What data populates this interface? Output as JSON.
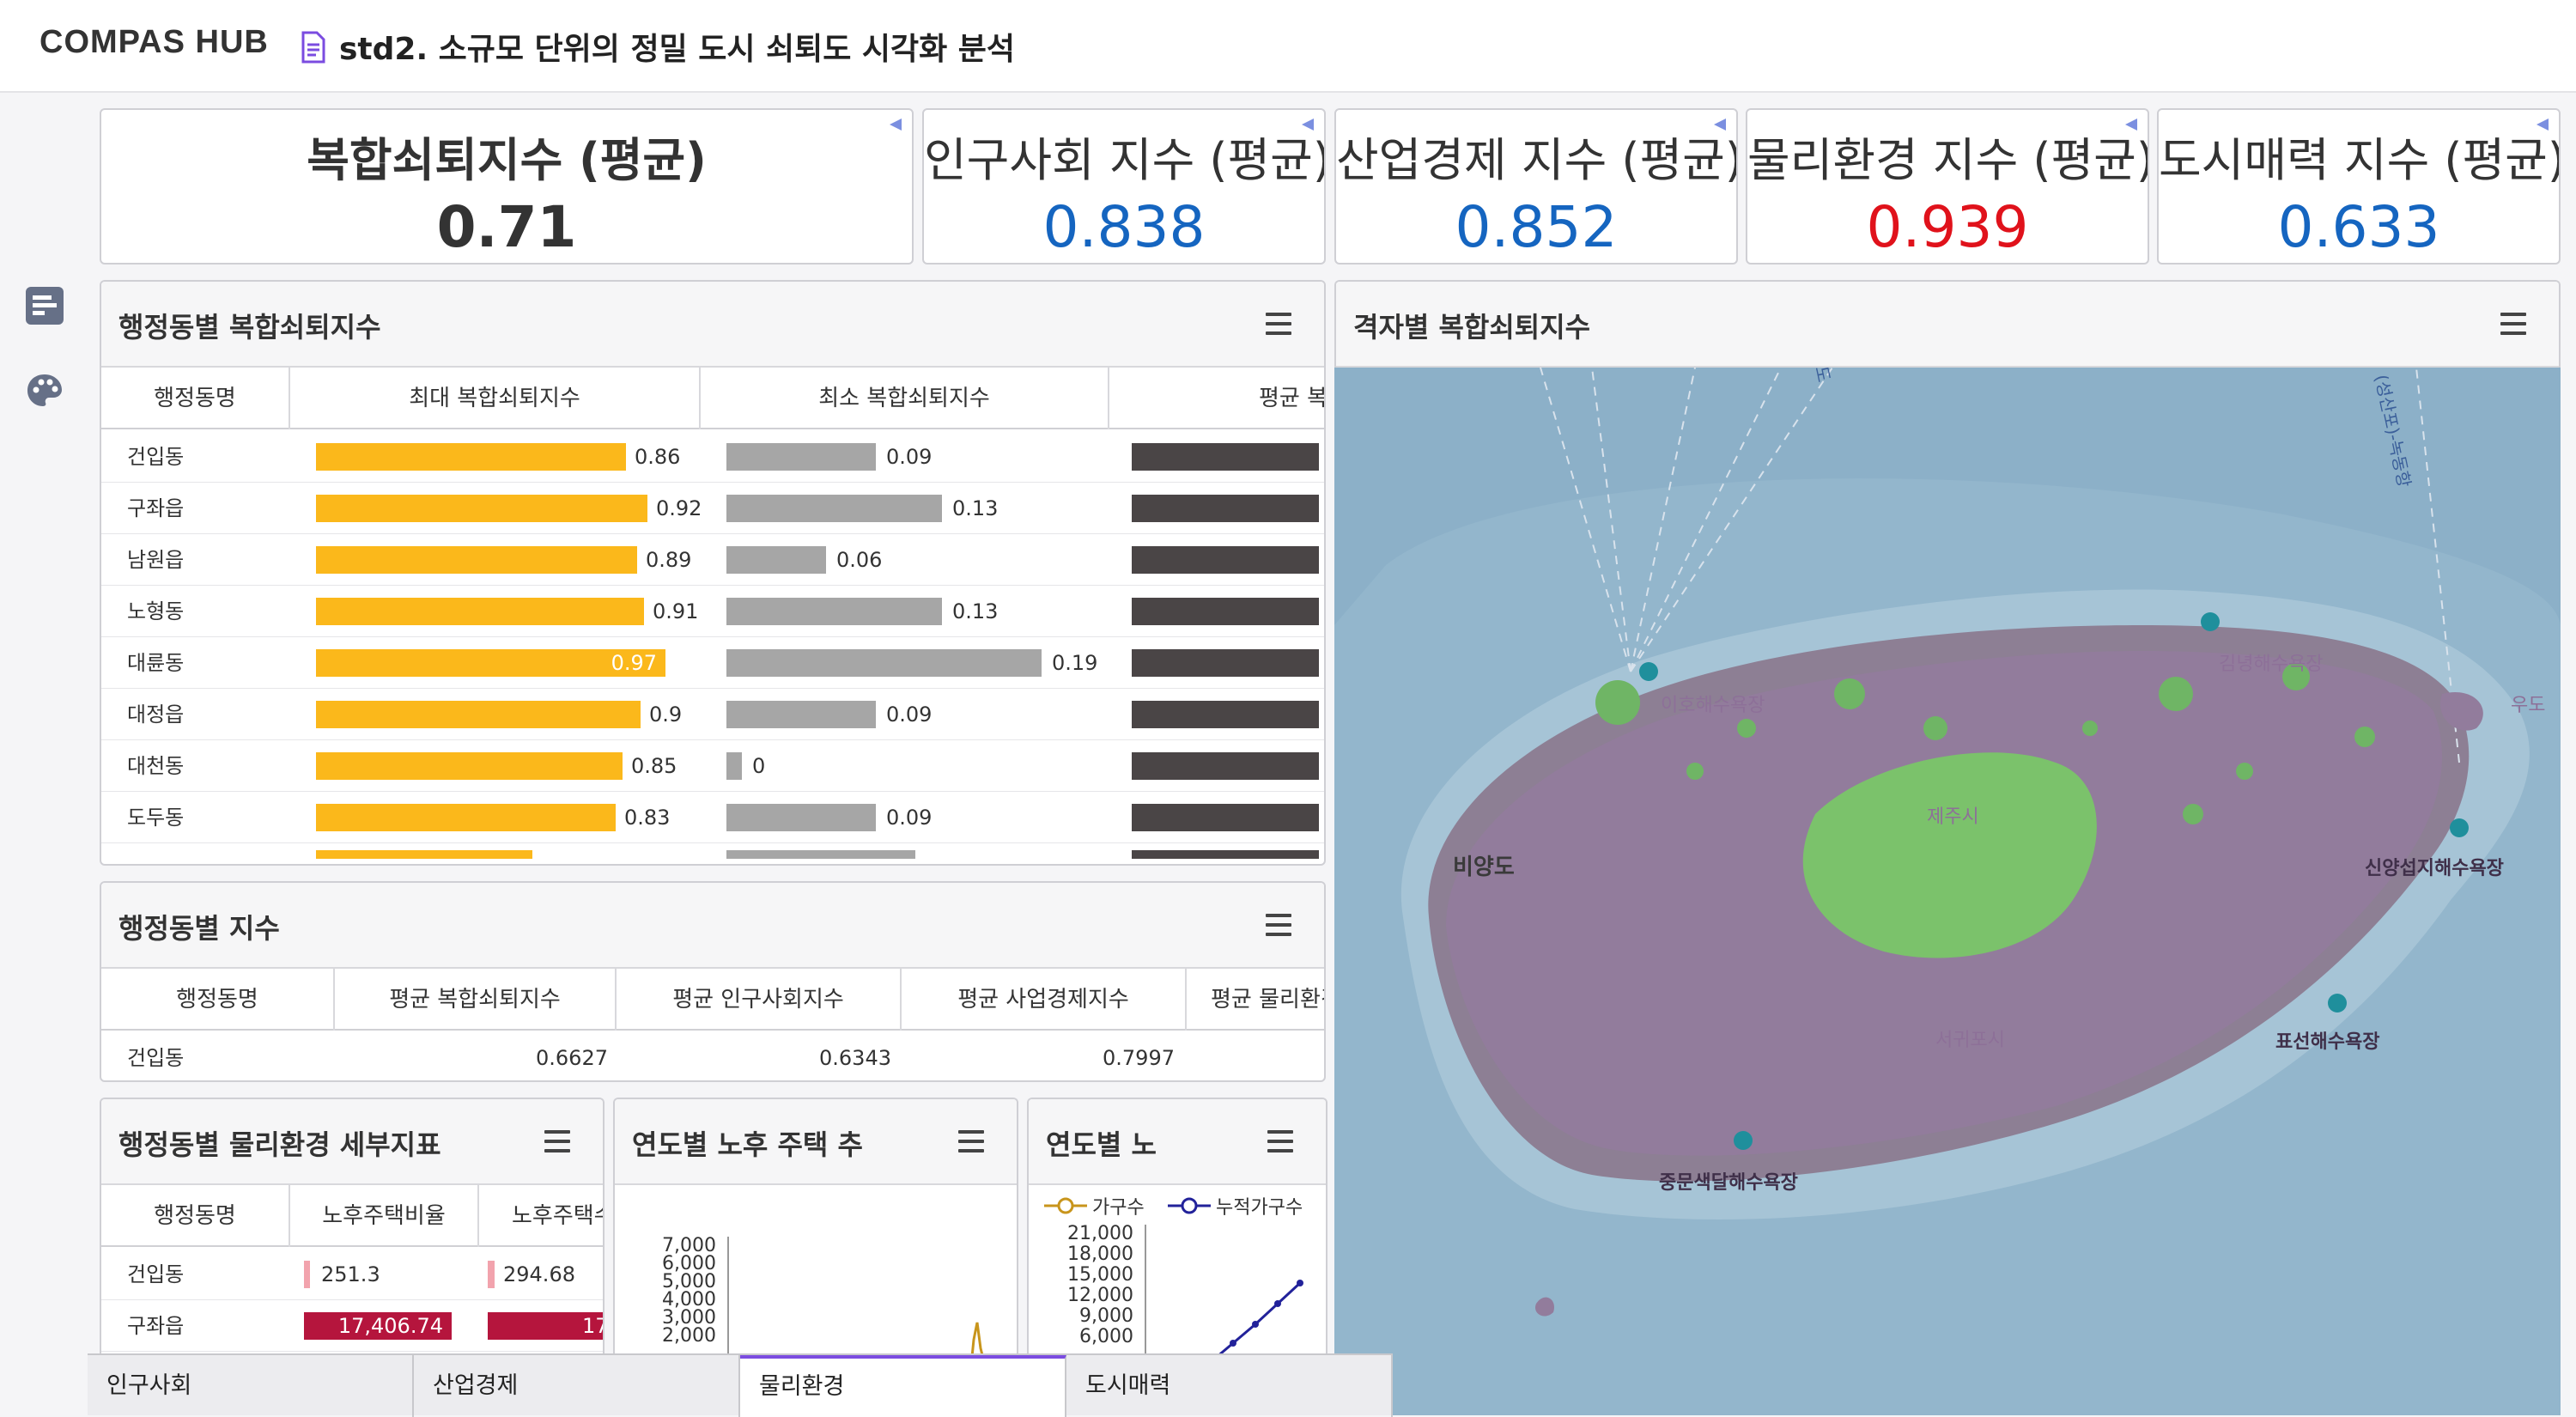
{
  "app": {
    "logo": "COMPAS HUB",
    "title": "std2. 소규모 단위의 정밀 도시 쇠퇴도 시각화 분석"
  },
  "kpis": [
    {
      "title": "복합쇠퇴지수  (평균)",
      "value": "0.71",
      "color": "#333333"
    },
    {
      "title": "인구사회 지수 (평균)",
      "value": "0.838",
      "color": "#1565c0"
    },
    {
      "title": "산업경제 지수 (평균)",
      "value": "0.852",
      "color": "#1565c0"
    },
    {
      "title": "물리환경 지수 (평균)",
      "value": "0.939",
      "color": "#e0121b"
    },
    {
      "title": "도시매력 지수 (평균)",
      "value": "0.633",
      "color": "#1565c0"
    }
  ],
  "panel_decline": {
    "title": "행정동별 복합쇠퇴지수",
    "columns": [
      "행정동명",
      "최대 복합쇠퇴지수",
      "최소 복합쇠퇴지수",
      "평균 복"
    ],
    "rows": [
      {
        "name": "건입동",
        "max": 0.86,
        "max_label": "0.86",
        "min": 0.09,
        "min_label": "0.09"
      },
      {
        "name": "구좌읍",
        "max": 0.92,
        "max_label": "0.92",
        "min": 0.13,
        "min_label": "0.13"
      },
      {
        "name": "남원읍",
        "max": 0.89,
        "max_label": "0.89",
        "min": 0.06,
        "min_label": "0.06"
      },
      {
        "name": "노형동",
        "max": 0.91,
        "max_label": "0.91",
        "min": 0.13,
        "min_label": "0.13"
      },
      {
        "name": "대륜동",
        "max": 0.97,
        "max_label": "0.97",
        "min": 0.19,
        "min_label": "0.19"
      },
      {
        "name": "대정읍",
        "max": 0.9,
        "max_label": "0.9",
        "min": 0.09,
        "min_label": "0.09"
      },
      {
        "name": "대천동",
        "max": 0.85,
        "max_label": "0.85",
        "min": 0.0,
        "min_label": "0"
      },
      {
        "name": "도두동",
        "max": 0.83,
        "max_label": "0.83",
        "min": 0.09,
        "min_label": "0.09"
      }
    ]
  },
  "panel_index": {
    "title": "행정동별 지수",
    "columns": [
      "행정동명",
      "평균 복합쇠퇴지수",
      "평균 인구사회지수",
      "평균 사업경제지수",
      "평균 물리환경"
    ],
    "rows": [
      {
        "name": "건입동",
        "v1": "0.6627",
        "v2": "0.6343",
        "v3": "0.7997"
      }
    ]
  },
  "panel_physical": {
    "title": "행정동별 물리환경 세부지표",
    "columns": [
      "행정동명",
      "노후주택비율",
      "노후주택수"
    ],
    "rows": [
      {
        "name": "건입동",
        "ratio": 251.3,
        "ratio_label": "251.3",
        "count_label": "294.68"
      },
      {
        "name": "구좌읍",
        "ratio": 17406.74,
        "ratio_label": "17,406.74",
        "count_label": "17,"
      }
    ]
  },
  "panel_trend": {
    "title": "연도별 노후 주택 추",
    "yticks": [
      "7,000",
      "6,000",
      "5,000",
      "4,000",
      "3,000",
      "2,000"
    ]
  },
  "panel_cumulative": {
    "title": "연도별 노",
    "legend": [
      "가구수",
      "누적가구수"
    ],
    "yticks": [
      "21,000",
      "18,000",
      "15,000",
      "12,000",
      "9,000",
      "6,000"
    ]
  },
  "panel_map": {
    "title": "격자별 복합쇠퇴지수",
    "labels": [
      "비양도",
      "제주시",
      "서귀포시",
      "김녕해수욕장",
      "이호해수욕장",
      "신양섭지해수욕장",
      "표선해수욕장",
      "중문색달해수욕장",
      "우도",
      "(성산포)-녹동항",
      "도"
    ]
  },
  "tabs": [
    "인구사회",
    "산업경제",
    "물리환경",
    "도시매력"
  ],
  "active_tab": "물리환경",
  "colors": {
    "accent": "#7b4ce0",
    "bar_max": "#fbb81b",
    "bar_min": "#a6a6a6",
    "bar_avg": "#4a4546",
    "bar_red": "#b5153d",
    "bar_pink": "#f2a3ad"
  }
}
